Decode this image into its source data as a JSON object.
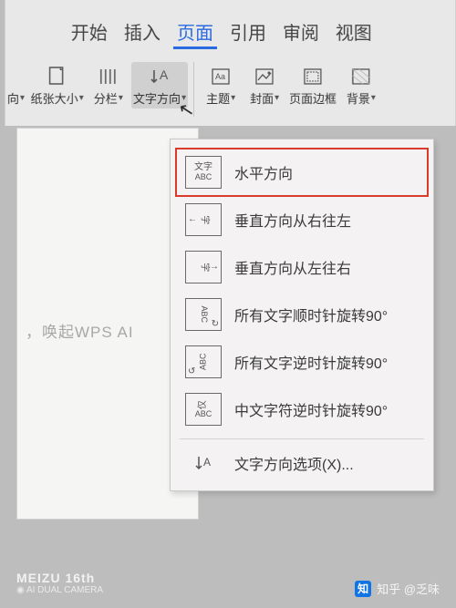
{
  "tabs": {
    "start": "开始",
    "insert": "插入",
    "page": "页面",
    "reference": "引用",
    "review": "审阅",
    "view": "视图"
  },
  "toolbar": {
    "orientation": "向",
    "paper_size": "纸张大小",
    "columns": "分栏",
    "text_direction": "文字方向",
    "theme": "主题",
    "cover": "封面",
    "page_border": "页面边框",
    "background": "背景"
  },
  "menu": {
    "items": [
      "水平方向",
      "垂直方向从右往左",
      "垂直方向从左往右",
      "所有文字顺时针旋转90°",
      "所有文字逆时针旋转90°",
      "中文字符逆时针旋转90°"
    ],
    "options": "文字方向选项(X)..."
  },
  "doc": {
    "hint": "，唤起WPS AI"
  },
  "watermark": {
    "brand": "MEIZU 16th",
    "sub": "AI DUAL CAMERA",
    "zh": "知",
    "author": "知乎 @乏味"
  }
}
